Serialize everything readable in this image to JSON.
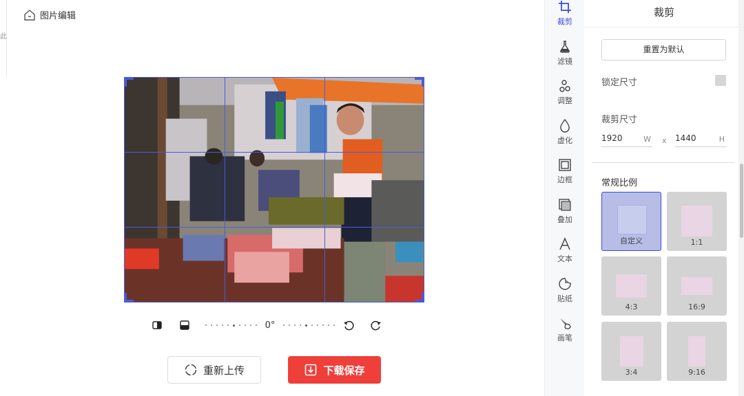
{
  "app": {
    "title": "图片编辑",
    "left_edge_char": "此"
  },
  "editor": {
    "rotation_label": "0°",
    "reupload_label": "重新上传",
    "save_label": "下载保存"
  },
  "rail": {
    "items": [
      {
        "label": "裁剪",
        "icon": "crop-icon",
        "active": true
      },
      {
        "label": "滤镜",
        "icon": "filter-flask-icon"
      },
      {
        "label": "调整",
        "icon": "adjust-icon"
      },
      {
        "label": "虚化",
        "icon": "blur-drop-icon"
      },
      {
        "label": "边框",
        "icon": "frame-icon"
      },
      {
        "label": "叠加",
        "icon": "overlay-icon"
      },
      {
        "label": "文本",
        "icon": "text-icon"
      },
      {
        "label": "贴纸",
        "icon": "sticker-icon"
      },
      {
        "label": "画笔",
        "icon": "brush-icon"
      }
    ]
  },
  "panel": {
    "title": "裁剪",
    "reset_label": "重置为默认",
    "lock_label": "锁定尺寸",
    "size_label": "裁剪尺寸",
    "width_value": "1920",
    "width_unit": "W",
    "separator": "x",
    "height_value": "1440",
    "height_unit": "H",
    "ratios_title": "常规比例",
    "ratios": [
      {
        "label": "自定义",
        "active": true
      },
      {
        "label": "1:1"
      },
      {
        "label": "4:3"
      },
      {
        "label": "16:9"
      },
      {
        "label": "3:4"
      },
      {
        "label": "9:16"
      }
    ]
  },
  "colors": {
    "accent": "#3b4cd9",
    "save": "#ef3f3a",
    "crop_line": "#4a5bd8"
  }
}
